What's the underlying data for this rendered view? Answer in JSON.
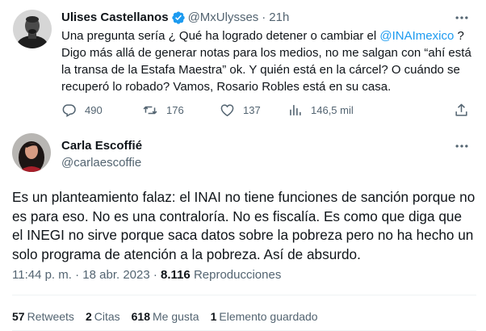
{
  "parent_tweet": {
    "author_name": "Ulises Castellanos",
    "handle": "@MxUlysses",
    "separator": "·",
    "time": "21h",
    "text_part1": "Una pregunta sería ¿ Qué ha logrado detener o cambiar el ",
    "mention": "@INAImexico",
    "text_part2": " ? Digo más allá de generar notas para los medios, no me salgan con “ahí está la transa de la Estafa Maestra” ok. Y quién está en la cárcel? O cuándo se recuperó lo robado? Vamos, Rosario Robles está en su casa.",
    "replies": "490",
    "retweets": "176",
    "likes": "137",
    "views": "146,5 mil",
    "verified_color": "#1d9bf0"
  },
  "main_tweet": {
    "author_name": "Carla Escoffié",
    "handle": "@carlaescoffie",
    "text": "Es un planteamiento falaz: el INAI no tiene funciones de sanción porque no es para eso. No es una contraloría. No es fiscalía. Es como que diga que el INEGI no sirve porque saca datos sobre la pobreza pero no ha hecho un solo programa de atención a la pobreza. Así de absurdo.",
    "time": "11:44 p. m.",
    "separator": "·",
    "date": "18 abr. 2023",
    "views_count": "8.116",
    "views_label": "Reproducciones",
    "stats": [
      {
        "value": "57",
        "label": "Retweets"
      },
      {
        "value": "2",
        "label": "Citas"
      },
      {
        "value": "618",
        "label": "Me gusta"
      },
      {
        "value": "1",
        "label": "Elemento guardado"
      }
    ]
  },
  "icons": {
    "more": "more-icon",
    "reply": "reply-icon",
    "retweet": "retweet-icon",
    "like": "heart-icon",
    "views": "views-icon",
    "verified": "verified-badge-icon"
  },
  "colors": {
    "text": "#0f1419",
    "secondary": "#536471",
    "accent": "#1d9bf0",
    "divider": "#eff3f4"
  }
}
